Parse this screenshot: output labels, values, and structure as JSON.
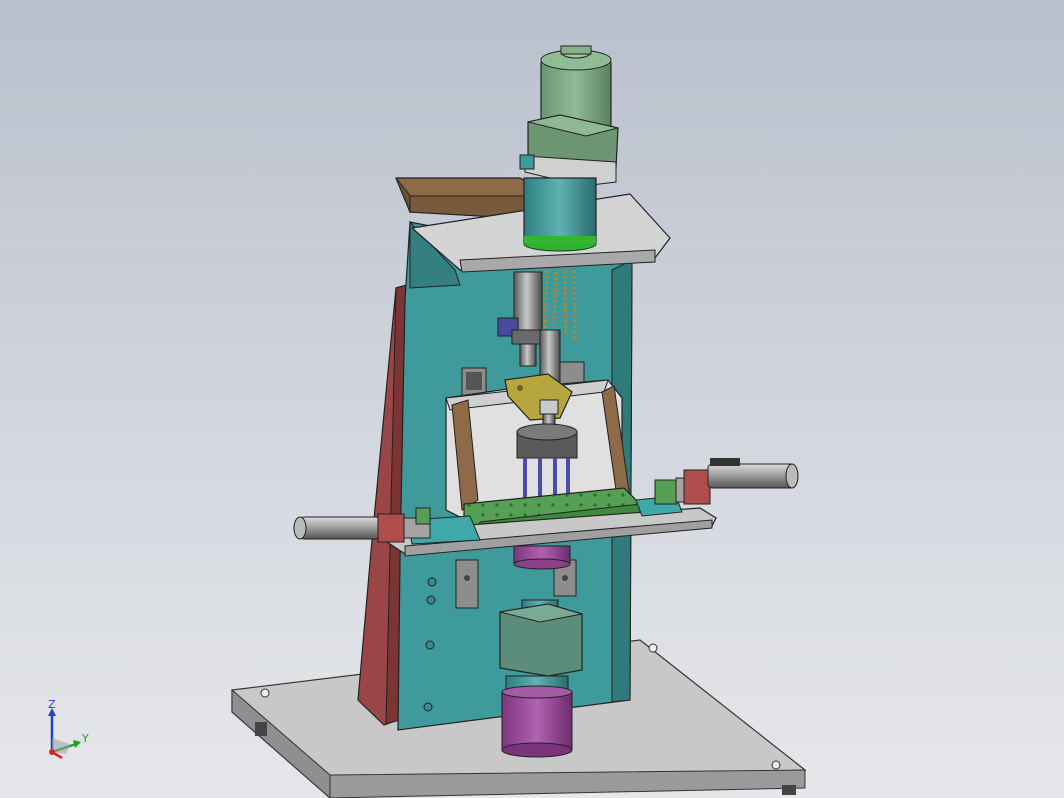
{
  "viewport": {
    "background_top": "#b9c0cc",
    "background_bottom": "#e6e7ea"
  },
  "triad": {
    "z_label": "Z",
    "y_label": "Y",
    "x_color": "#e02020",
    "y_color": "#20a020",
    "z_color": "#2040d0"
  },
  "colors": {
    "frame_teal": "#3c9a9a",
    "frame_red": "#9a4646",
    "plate_gray": "#c9c9c9",
    "brown": "#8e6a48",
    "motor_green": "#6f9a76",
    "magenta": "#9a4a9a",
    "green_plate": "#55a055",
    "gold": "#b7a640",
    "blue_pin": "#4b4bb0"
  }
}
